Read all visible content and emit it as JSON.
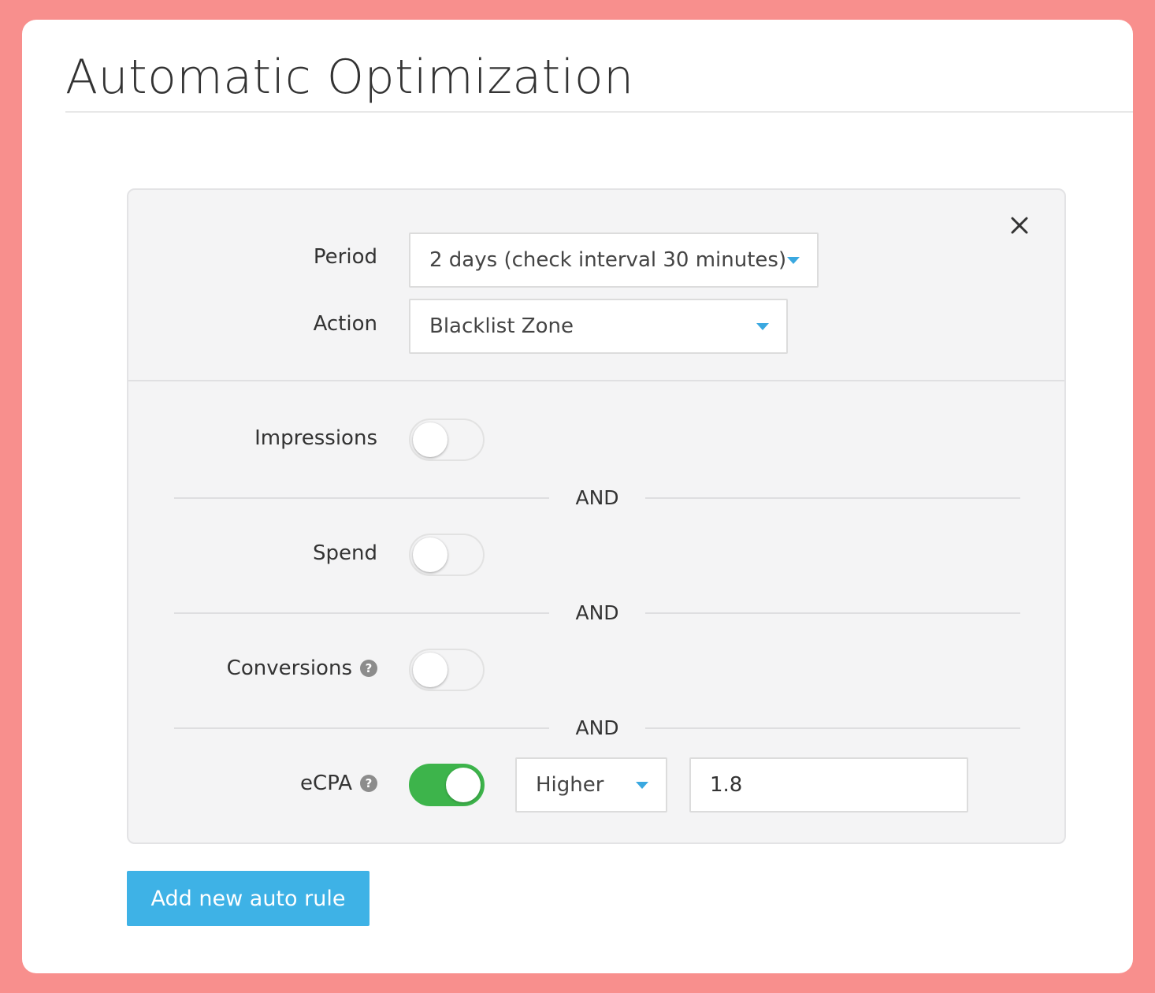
{
  "page": {
    "title": "Automatic Optimization"
  },
  "rule": {
    "period": {
      "label": "Period",
      "value": "2 days (check interval 30 minutes)"
    },
    "action": {
      "label": "Action",
      "value": "Blacklist Zone"
    },
    "conditions": [
      {
        "label": "Impressions",
        "enabled": false
      },
      {
        "label": "Spend",
        "enabled": false
      },
      {
        "label": "Conversions",
        "enabled": false,
        "help_icon": "question-circle-icon"
      },
      {
        "label": "eCPA",
        "enabled": true,
        "help_icon": "question-circle-icon",
        "comparator": "Higher",
        "value": "1.8"
      }
    ],
    "joiner": "AND",
    "close_icon": "close-icon"
  },
  "buttons": {
    "add_rule": "Add new auto rule"
  },
  "colors": {
    "background": "#f88f8d",
    "accent": "#3eb2e6",
    "toggle_on": "#3db44b",
    "caret": "#3aa8e0"
  }
}
